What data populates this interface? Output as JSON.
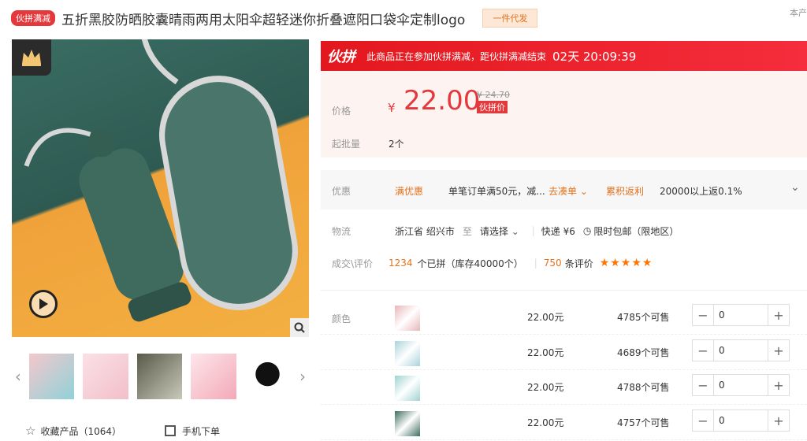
{
  "title": {
    "badge": "伙拼满减",
    "text": "五折黑胶防晒胶囊晴雨两用太阳伞超轻迷你折叠遮阳口袋伞定制logo",
    "drop_ship": "一件代发",
    "right_text": "本产"
  },
  "gallery": {
    "crown_icon": "crown-icon",
    "play_icon": "play-icon",
    "zoom_icon": "search-icon",
    "prev_arrow": "‹",
    "next_arrow": "›",
    "thumbs": [
      "pink-umbrella",
      "pink-case",
      "forest-umbrella",
      "pink-set",
      "black-umbrella"
    ],
    "favorite_label": "收藏产品（1064）",
    "mobile_order_label": "手机下单"
  },
  "promo": {
    "logo": "伙拼",
    "text": "此商品正在参加伙拼满减，距伙拼满减结束",
    "timer": "02天 20:09:39"
  },
  "price": {
    "label": "价格",
    "currency": "¥",
    "value": "22.00",
    "old_price": "¥ 24.70",
    "tag": "伙拼价",
    "moq_label": "起批量",
    "moq_value": "2个"
  },
  "coupon": {
    "label": "优惠",
    "tag1": "满优惠",
    "text1": "单笔订单满50元，减...",
    "link1": "去凑单",
    "tag2": "累积返利",
    "text2": "20000以上返0.1%"
  },
  "logistics": {
    "label": "物流",
    "from": "浙江省 绍兴市",
    "to_word": "至",
    "select": "请选择",
    "express": "快递 ¥6",
    "guarantee": "限时包邮（限地区）"
  },
  "deals": {
    "label": "成交\\评价",
    "count": "1234",
    "count_text": "个已拼（库存40000个）",
    "sep": "|",
    "reviews": "750",
    "reviews_text": "条评价",
    "stars": "★★★★★",
    "rating": 5
  },
  "sku": {
    "label": "颜色",
    "rows": [
      {
        "price": "22.00元",
        "stock": "4785个可售",
        "qty": "0",
        "color": "#e8b7b9"
      },
      {
        "price": "22.00元",
        "stock": "4689个可售",
        "qty": "0",
        "color": "#a9d3da"
      },
      {
        "price": "22.00元",
        "stock": "4788个可售",
        "qty": "0",
        "color": "#9fd3d2"
      },
      {
        "price": "22.00元",
        "stock": "4757个可售",
        "qty": "0",
        "color": "#3f6e60"
      }
    ],
    "minus": "−",
    "plus": "+"
  },
  "colors": {
    "accent": "#e4393c",
    "orange": "#e4721c"
  }
}
